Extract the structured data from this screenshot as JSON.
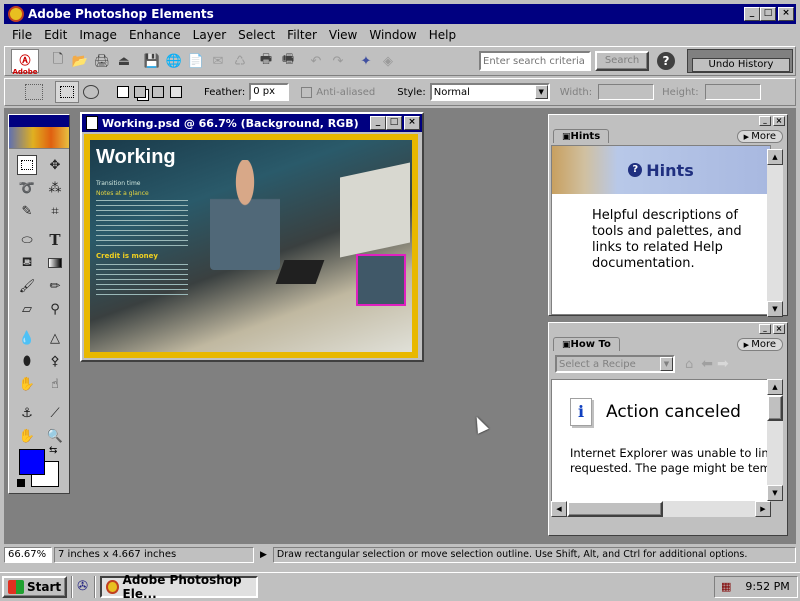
{
  "app": {
    "title": "Adobe Photoshop Elements"
  },
  "menu": [
    "File",
    "Edit",
    "Image",
    "Enhance",
    "Layer",
    "Select",
    "Filter",
    "View",
    "Window",
    "Help"
  ],
  "toolbar": {
    "adobe_label": "Adobe",
    "search_placeholder": "Enter search criteria",
    "search_button": "Search",
    "undo_history": "Undo History"
  },
  "options": {
    "feather_label": "Feather:",
    "feather_value": "0 px",
    "anti_aliased": "Anti-aliased",
    "style_label": "Style:",
    "style_value": "Normal",
    "width_label": "Width:",
    "height_label": "Height:"
  },
  "document": {
    "title": "Working.psd @ 66.7% (Background, RGB)",
    "heading": "Working",
    "subhead": "Credit is money",
    "caption1": "Transition time",
    "caption2": "Notes at a glance"
  },
  "hints": {
    "tab": "Hints",
    "more": "More",
    "header": "Hints",
    "body": "Helpful descriptions of tools and palettes, and links to related Help documentation."
  },
  "howto": {
    "tab": "How To",
    "more": "More",
    "recipe_placeholder": "Select a Recipe",
    "message_title": "Action canceled",
    "message_body": "Internet Explorer was unable to link requested. The page might be temp"
  },
  "status": {
    "zoom": "66.67%",
    "size": "7 inches x 4.667 inches",
    "hint": "Draw rectangular selection or move selection outline.  Use Shift, Alt, and Ctrl for additional options."
  },
  "taskbar": {
    "start": "Start",
    "task": "Adobe Photoshop Ele...",
    "clock": "9:52 PM"
  },
  "colors": {
    "foreground": "#0000ff",
    "background": "#ffffff",
    "titlebar": "#000080"
  }
}
